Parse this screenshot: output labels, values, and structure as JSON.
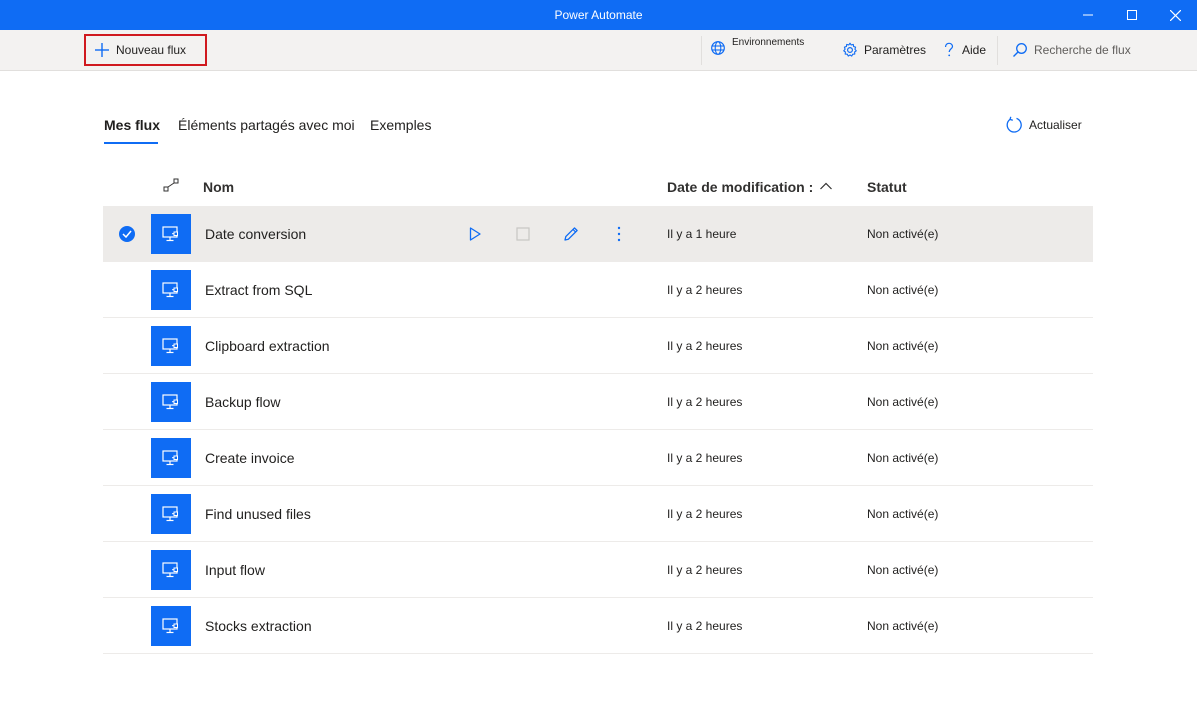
{
  "window": {
    "title": "Power Automate",
    "accent_color": "#0f6cf4"
  },
  "toolbar": {
    "new_flow_label": "Nouveau flux",
    "environments_label": "Environnements",
    "settings_label": "Paramètres",
    "help_label": "Aide",
    "search_placeholder": "Recherche de flux"
  },
  "tabs": [
    {
      "label": "Mes flux",
      "active": true
    },
    {
      "label": "Éléments partagés avec moi",
      "active": false
    },
    {
      "label": "Exemples",
      "active": false
    }
  ],
  "refresh_label": "Actualiser",
  "table": {
    "columns": {
      "name": "Nom",
      "modified": "Date de modification :",
      "status": "Statut"
    },
    "rows": [
      {
        "name": "Date conversion",
        "modified": "Il y a 1 heure",
        "status": "Non activé(e)",
        "selected": true
      },
      {
        "name": "Extract from SQL",
        "modified": "Il y a 2 heures",
        "status": "Non activé(e)",
        "selected": false
      },
      {
        "name": "Clipboard extraction",
        "modified": "Il y a 2 heures",
        "status": "Non activé(e)",
        "selected": false
      },
      {
        "name": "Backup flow",
        "modified": "Il y a 2 heures",
        "status": "Non activé(e)",
        "selected": false
      },
      {
        "name": "Create invoice",
        "modified": "Il y a 2 heures",
        "status": "Non activé(e)",
        "selected": false
      },
      {
        "name": "Find unused files",
        "modified": "Il y a 2 heures",
        "status": "Non activé(e)",
        "selected": false
      },
      {
        "name": "Input flow",
        "modified": "Il y a 2 heures",
        "status": "Non activé(e)",
        "selected": false
      },
      {
        "name": "Stocks extraction",
        "modified": "Il y a 2 heures",
        "status": "Non activé(e)",
        "selected": false
      }
    ]
  },
  "icons": {
    "window": [
      "minimize-icon",
      "maximize-icon",
      "close-icon"
    ],
    "toolbar": [
      "plus-icon",
      "globe-icon",
      "gear-icon",
      "question-icon",
      "search-icon"
    ],
    "row": [
      "desktop-flow-icon",
      "play-icon",
      "stop-icon",
      "edit-icon",
      "more-icon",
      "checkmark-icon"
    ]
  }
}
